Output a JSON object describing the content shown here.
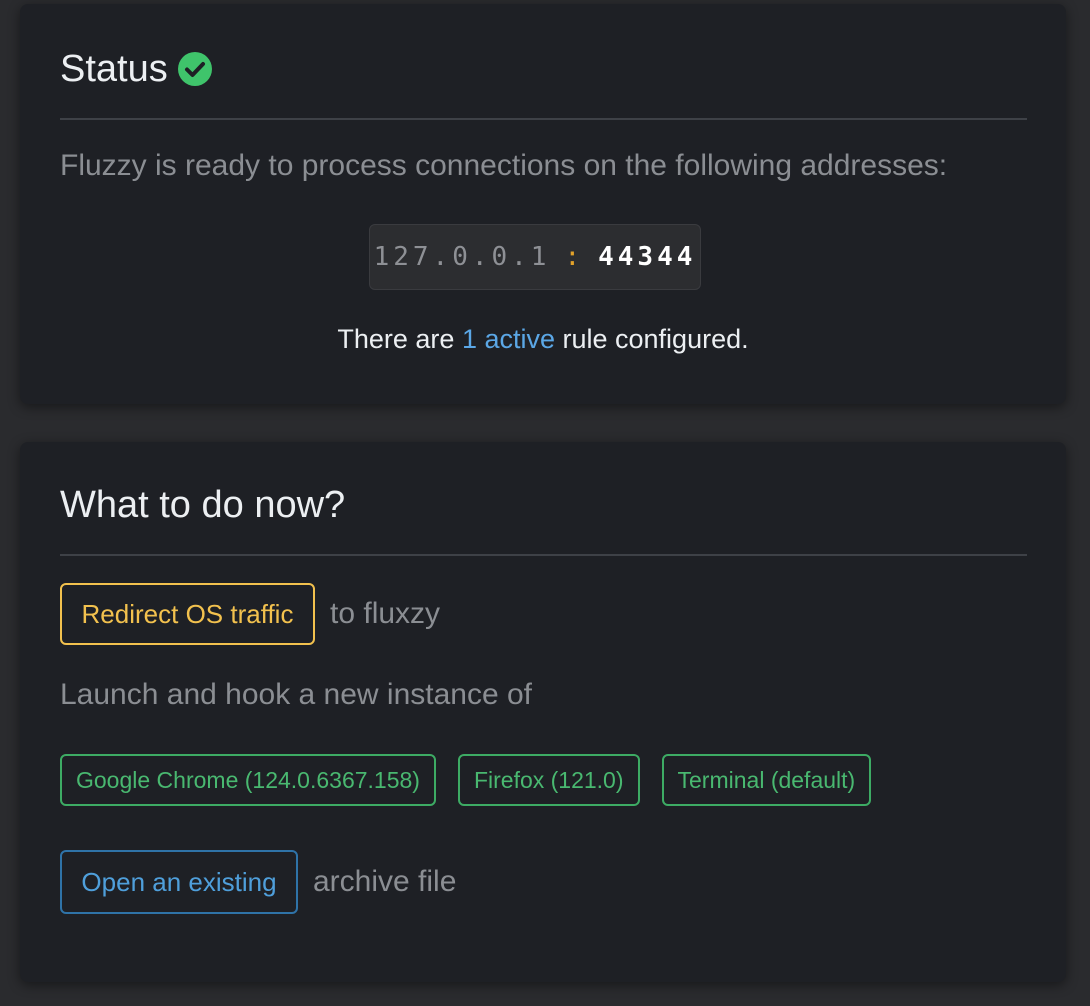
{
  "status": {
    "title": "Status",
    "description": "Fluzzy is ready to process connections on the following addresses:",
    "address": {
      "ip": "127.0.0.1",
      "separator": ":",
      "port": "44344"
    },
    "rules": {
      "prefix": "There are ",
      "count_link": "1 active",
      "suffix": " rule configured."
    },
    "icon": "check-circle-icon",
    "icon_color": "#3fc46b"
  },
  "todo": {
    "title": "What to do now?",
    "redirect_button": "Redirect OS traffic",
    "redirect_suffix": "to fluxzy",
    "launch_text": "Launch and hook a new instance of",
    "browsers": [
      {
        "label": "Google Chrome (124.0.6367.158)"
      },
      {
        "label": "Firefox (121.0)"
      },
      {
        "label": "Terminal (default)"
      }
    ],
    "open_button": "Open an existing",
    "open_suffix": "archive file"
  },
  "colors": {
    "background": "#2a2b2e",
    "card": "#1e2025",
    "accent_yellow": "#f2c14e",
    "accent_green": "#3dab64",
    "accent_blue": "#4f9fdb"
  }
}
